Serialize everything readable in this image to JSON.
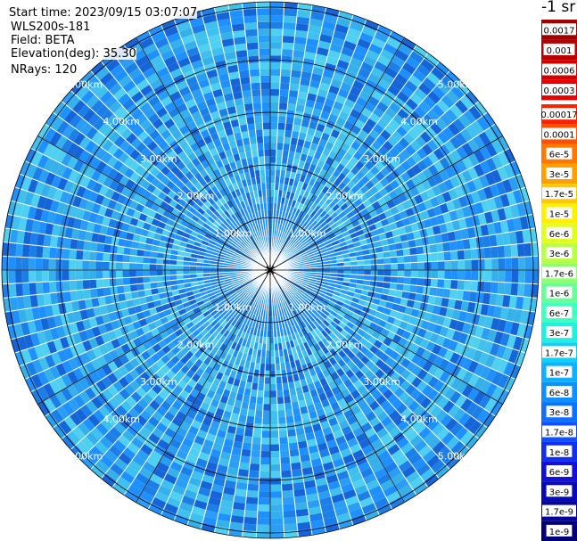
{
  "header": {
    "start_time": "Start time: 2023/09/15 03:07:07",
    "instrument": "WLS200s-181",
    "field": "Field: BETA",
    "elevation": "Elevation(deg): 35.30",
    "nrays": "NRays: 120"
  },
  "map": {
    "ring_labels": [
      "1.00km",
      "2.00km",
      "3.00km",
      "4.00km",
      "5.00km"
    ],
    "ring_count": 5,
    "radial_line_count": 12,
    "field_colors": [
      "#1e90ff",
      "#2a9df4",
      "#35b0ea",
      "#3fc0ef",
      "#1c7fe8",
      "#4fd0f2",
      "#1565d8"
    ]
  },
  "legend": {
    "unit": "-1 sr",
    "entries": [
      {
        "label": "0.0017",
        "color": "#a00000"
      },
      {
        "label": "0.001",
        "color": "#b80000"
      },
      {
        "label": "0.0006",
        "color": "#d00000"
      },
      {
        "label": "0.0003",
        "color": "#e80000"
      },
      {
        "label": "0.00017",
        "color": "#ff2000"
      },
      {
        "label": "0.0001",
        "color": "#ff5000"
      },
      {
        "label": "6e-5",
        "color": "#ff7800"
      },
      {
        "label": "3e-5",
        "color": "#ffa000"
      },
      {
        "label": "1.7e-5",
        "color": "#ffc800"
      },
      {
        "label": "1e-5",
        "color": "#fff000"
      },
      {
        "label": "6e-6",
        "color": "#e0ff20"
      },
      {
        "label": "3e-6",
        "color": "#b8ff48"
      },
      {
        "label": "1.7e-6",
        "color": "#90ff70"
      },
      {
        "label": "1e-6",
        "color": "#68ff98"
      },
      {
        "label": "6e-7",
        "color": "#40ffc0"
      },
      {
        "label": "3e-7",
        "color": "#20f0e0"
      },
      {
        "label": "1.7e-7",
        "color": "#10d0f8"
      },
      {
        "label": "1e-7",
        "color": "#10b0ff"
      },
      {
        "label": "6e-8",
        "color": "#1090ff"
      },
      {
        "label": "3e-8",
        "color": "#1070ff"
      },
      {
        "label": "1.7e-8",
        "color": "#1050ff"
      },
      {
        "label": "1e-8",
        "color": "#1030f0"
      },
      {
        "label": "6e-9",
        "color": "#1010d8"
      },
      {
        "label": "3e-9",
        "color": "#0808b8"
      },
      {
        "label": "1.7e-9",
        "color": "#040498"
      },
      {
        "label": "1e-9",
        "color": "#000078"
      }
    ]
  }
}
